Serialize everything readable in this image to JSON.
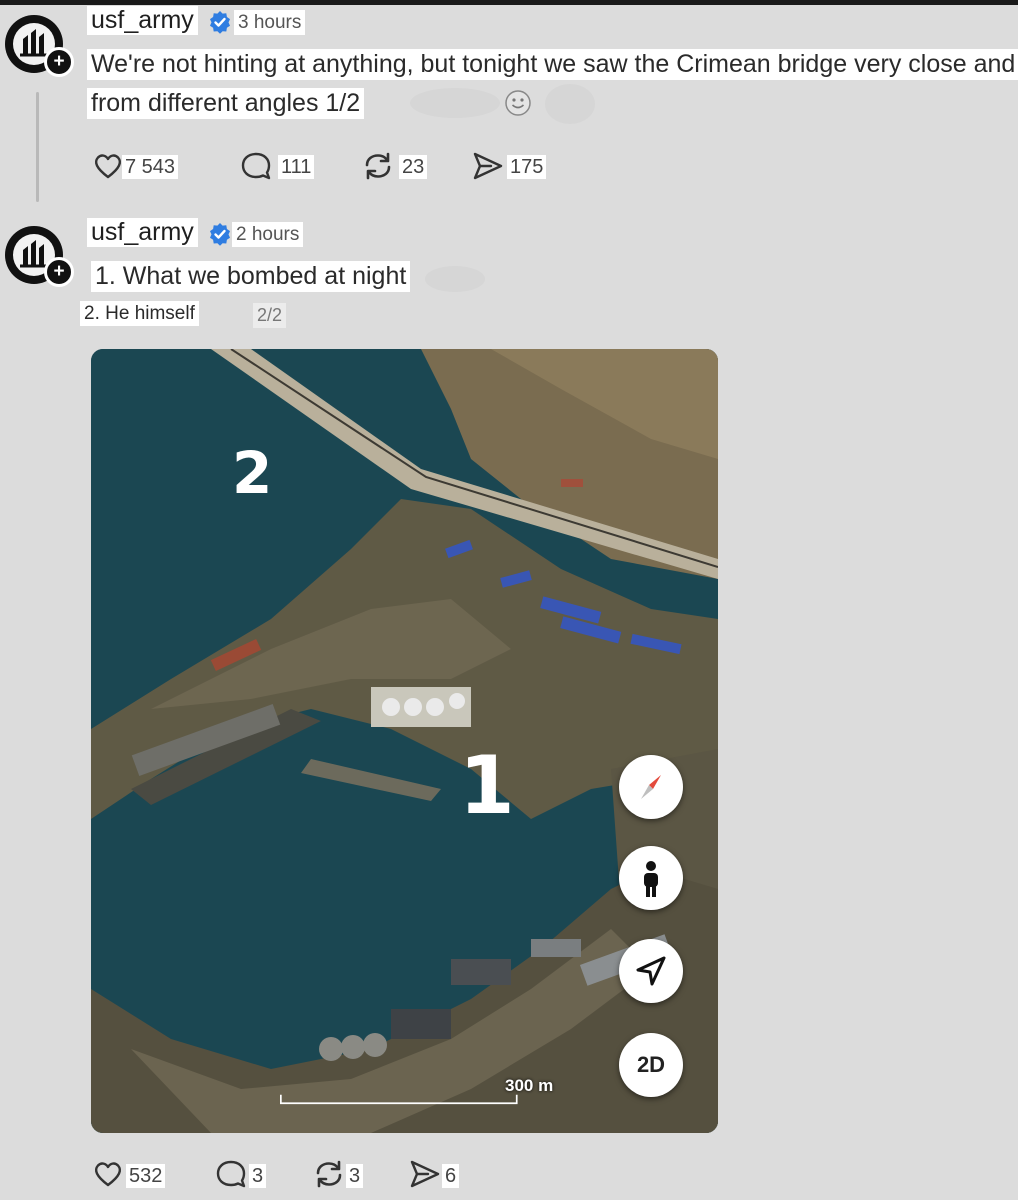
{
  "posts": [
    {
      "username": "usf_army",
      "time": "3 hours",
      "text_line1": "We're not hinting at anything, but tonight we saw the Crimean bridge very close and",
      "text_line2": "from different angles 1/2",
      "actions": {
        "likes": "7 543",
        "replies": "111",
        "reposts": "23",
        "shares": "175"
      }
    },
    {
      "username": "usf_army",
      "time": "2 hours",
      "text_line1": "1. What we bombed at night",
      "text_line2": "2. He himself",
      "counter": "2/2",
      "map": {
        "label_1": "1",
        "label_2": "2",
        "scale": "300 m",
        "mode_button": "2D",
        "buttons": [
          "compass-icon",
          "street-view-person-icon",
          "navigate-arrow-icon"
        ]
      },
      "actions": {
        "likes": "532",
        "replies": "3",
        "reposts": "3",
        "shares": "6"
      }
    }
  ],
  "colors": {
    "verified": "#2f7de1",
    "water": "#1b4752",
    "land": "#6f6852",
    "roof_blue": "#3956b4"
  }
}
